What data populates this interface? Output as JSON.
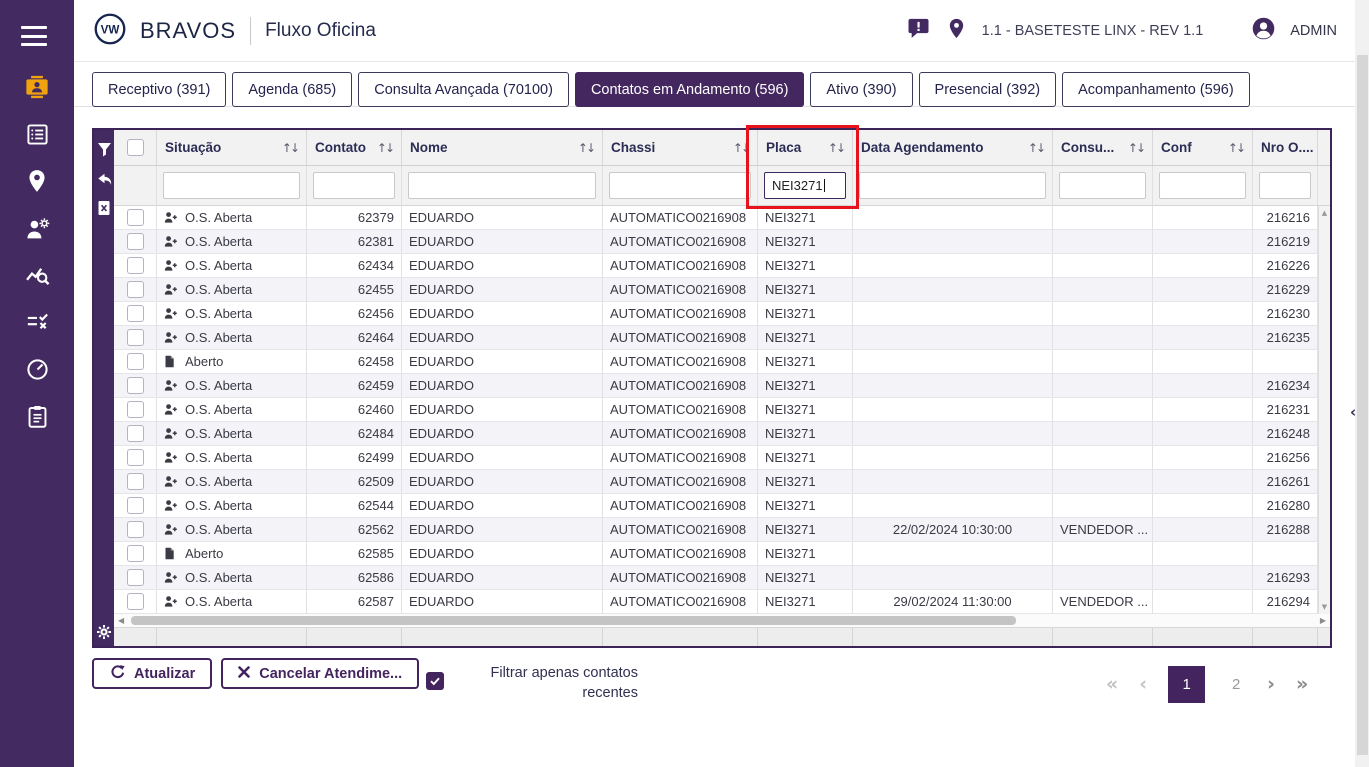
{
  "app": {
    "brand": "BRAVOS",
    "page_title": "Fluxo Oficina",
    "environment": "1.1 - BASETESTE LINX - REV 1.1",
    "user": "ADMIN"
  },
  "sidebar": {
    "items": [
      "menu",
      "contact-card",
      "service-list",
      "location",
      "mechanic",
      "chart-search",
      "checklist",
      "gauge",
      "clipboard"
    ],
    "active_item": "contact-card"
  },
  "tabs": [
    {
      "label": "Receptivo (391)",
      "active": false
    },
    {
      "label": "Agenda (685)",
      "active": false
    },
    {
      "label": "Consulta Avançada (70100)",
      "active": false
    },
    {
      "label": "Contatos em Andamento (596)",
      "active": true
    },
    {
      "label": "Ativo (390)",
      "active": false
    },
    {
      "label": "Presencial (392)",
      "active": false
    },
    {
      "label": "Acompanhamento (596)",
      "active": false
    }
  ],
  "table": {
    "tool_icons": [
      "filter",
      "undo",
      "export-excel",
      "settings"
    ],
    "columns": [
      {
        "key": "situacao",
        "label": "Situação"
      },
      {
        "key": "contato",
        "label": "Contato"
      },
      {
        "key": "nome",
        "label": "Nome"
      },
      {
        "key": "chassi",
        "label": "Chassi"
      },
      {
        "key": "placa",
        "label": "Placa"
      },
      {
        "key": "data_agendamento",
        "label": "Data Agendamento"
      },
      {
        "key": "consultor",
        "label": "Consu..."
      },
      {
        "key": "conf",
        "label": "Conf"
      },
      {
        "key": "nro_os",
        "label": "Nro O...."
      }
    ],
    "filters": {
      "placa": "NEI3271"
    },
    "highlighted_column": "placa",
    "rows": [
      {
        "situacao_icon": "person-plus",
        "situacao": "O.S. Aberta",
        "contato": "62379",
        "nome": "EDUARDO",
        "chassi": "AUTOMATICO0216908",
        "placa": "NEI3271",
        "data_agendamento": "",
        "consultor": "",
        "conf": "",
        "nro_os": "216216"
      },
      {
        "situacao_icon": "person-plus",
        "situacao": "O.S. Aberta",
        "contato": "62381",
        "nome": "EDUARDO",
        "chassi": "AUTOMATICO0216908",
        "placa": "NEI3271",
        "data_agendamento": "",
        "consultor": "",
        "conf": "",
        "nro_os": "216219"
      },
      {
        "situacao_icon": "person-plus",
        "situacao": "O.S. Aberta",
        "contato": "62434",
        "nome": "EDUARDO",
        "chassi": "AUTOMATICO0216908",
        "placa": "NEI3271",
        "data_agendamento": "",
        "consultor": "",
        "conf": "",
        "nro_os": "216226"
      },
      {
        "situacao_icon": "person-plus",
        "situacao": "O.S. Aberta",
        "contato": "62455",
        "nome": "EDUARDO",
        "chassi": "AUTOMATICO0216908",
        "placa": "NEI3271",
        "data_agendamento": "",
        "consultor": "",
        "conf": "",
        "nro_os": "216229"
      },
      {
        "situacao_icon": "person-plus",
        "situacao": "O.S. Aberta",
        "contato": "62456",
        "nome": "EDUARDO",
        "chassi": "AUTOMATICO0216908",
        "placa": "NEI3271",
        "data_agendamento": "",
        "consultor": "",
        "conf": "",
        "nro_os": "216230"
      },
      {
        "situacao_icon": "person-plus",
        "situacao": "O.S. Aberta",
        "contato": "62464",
        "nome": "EDUARDO",
        "chassi": "AUTOMATICO0216908",
        "placa": "NEI3271",
        "data_agendamento": "",
        "consultor": "",
        "conf": "",
        "nro_os": "216235"
      },
      {
        "situacao_icon": "file",
        "situacao": "Aberto",
        "contato": "62458",
        "nome": "EDUARDO",
        "chassi": "AUTOMATICO0216908",
        "placa": "NEI3271",
        "data_agendamento": "",
        "consultor": "",
        "conf": "",
        "nro_os": ""
      },
      {
        "situacao_icon": "person-plus",
        "situacao": "O.S. Aberta",
        "contato": "62459",
        "nome": "EDUARDO",
        "chassi": "AUTOMATICO0216908",
        "placa": "NEI3271",
        "data_agendamento": "",
        "consultor": "",
        "conf": "",
        "nro_os": "216234"
      },
      {
        "situacao_icon": "person-plus",
        "situacao": "O.S. Aberta",
        "contato": "62460",
        "nome": "EDUARDO",
        "chassi": "AUTOMATICO0216908",
        "placa": "NEI3271",
        "data_agendamento": "",
        "consultor": "",
        "conf": "",
        "nro_os": "216231"
      },
      {
        "situacao_icon": "person-plus",
        "situacao": "O.S. Aberta",
        "contato": "62484",
        "nome": "EDUARDO",
        "chassi": "AUTOMATICO0216908",
        "placa": "NEI3271",
        "data_agendamento": "",
        "consultor": "",
        "conf": "",
        "nro_os": "216248"
      },
      {
        "situacao_icon": "person-plus",
        "situacao": "O.S. Aberta",
        "contato": "62499",
        "nome": "EDUARDO",
        "chassi": "AUTOMATICO0216908",
        "placa": "NEI3271",
        "data_agendamento": "",
        "consultor": "",
        "conf": "",
        "nro_os": "216256"
      },
      {
        "situacao_icon": "person-plus",
        "situacao": "O.S. Aberta",
        "contato": "62509",
        "nome": "EDUARDO",
        "chassi": "AUTOMATICO0216908",
        "placa": "NEI3271",
        "data_agendamento": "",
        "consultor": "",
        "conf": "",
        "nro_os": "216261"
      },
      {
        "situacao_icon": "person-plus",
        "situacao": "O.S. Aberta",
        "contato": "62544",
        "nome": "EDUARDO",
        "chassi": "AUTOMATICO0216908",
        "placa": "NEI3271",
        "data_agendamento": "",
        "consultor": "",
        "conf": "",
        "nro_os": "216280"
      },
      {
        "situacao_icon": "person-plus",
        "situacao": "O.S. Aberta",
        "contato": "62562",
        "nome": "EDUARDO",
        "chassi": "AUTOMATICO0216908",
        "placa": "NEI3271",
        "data_agendamento": "22/02/2024 10:30:00",
        "consultor": "VENDEDOR ...",
        "conf": "",
        "nro_os": "216288"
      },
      {
        "situacao_icon": "file",
        "situacao": "Aberto",
        "contato": "62585",
        "nome": "EDUARDO",
        "chassi": "AUTOMATICO0216908",
        "placa": "NEI3271",
        "data_agendamento": "",
        "consultor": "",
        "conf": "",
        "nro_os": ""
      },
      {
        "situacao_icon": "person-plus",
        "situacao": "O.S. Aberta",
        "contato": "62586",
        "nome": "EDUARDO",
        "chassi": "AUTOMATICO0216908",
        "placa": "NEI3271",
        "data_agendamento": "",
        "consultor": "",
        "conf": "",
        "nro_os": "216293"
      },
      {
        "situacao_icon": "person-plus",
        "situacao": "O.S. Aberta",
        "contato": "62587",
        "nome": "EDUARDO",
        "chassi": "AUTOMATICO0216908",
        "placa": "NEI3271",
        "data_agendamento": "29/02/2024 11:30:00",
        "consultor": "VENDEDOR ...",
        "conf": "",
        "nro_os": "216294"
      }
    ]
  },
  "footer": {
    "refresh_label": "Atualizar",
    "cancel_label": "Cancelar Atendime...",
    "filter_recent_label_line1": "Filtrar apenas contatos",
    "filter_recent_label_line2": "recentes",
    "filter_recent_checked": true,
    "pagination": {
      "first": "«",
      "prev": "‹",
      "pages": [
        "1",
        "2"
      ],
      "active": "1",
      "next": "›",
      "last": "»"
    }
  },
  "icons": {
    "sort": "↑↓",
    "scroll_up": "▲",
    "scroll_down": "▼",
    "scroll_left": "◀",
    "scroll_right": "▶",
    "collapse": "‹"
  },
  "colors": {
    "primary_purple": "#432a60",
    "active_icon_amber": "#f0a30f",
    "highlight_red": "#e8121c"
  }
}
